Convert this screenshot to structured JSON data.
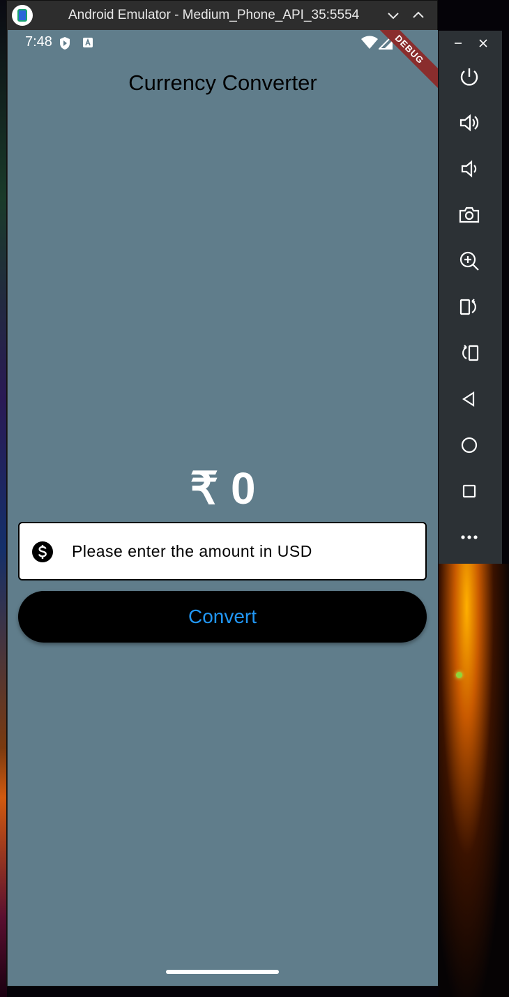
{
  "window": {
    "title": "Android Emulator - Medium_Phone_API_35:5554"
  },
  "status_bar": {
    "time": "7:48",
    "debug_label": "DEBUG"
  },
  "app": {
    "title": "Currency Converter",
    "result": "₹ 0",
    "amount_placeholder": "Please enter the amount in USD",
    "amount_value": "",
    "convert_label": "Convert"
  },
  "colors": {
    "screen_background": "#607d8b",
    "button_background": "#000000",
    "button_text": "#2196f3"
  },
  "side_panel": {
    "window_controls": [
      "minimize-icon",
      "close-icon"
    ],
    "buttons": [
      "power-icon",
      "volume-up-icon",
      "volume-down-icon",
      "camera-icon",
      "zoom-icon",
      "rotate-left-icon",
      "rotate-right-icon",
      "back-icon",
      "home-icon",
      "overview-icon",
      "more-icon"
    ]
  }
}
